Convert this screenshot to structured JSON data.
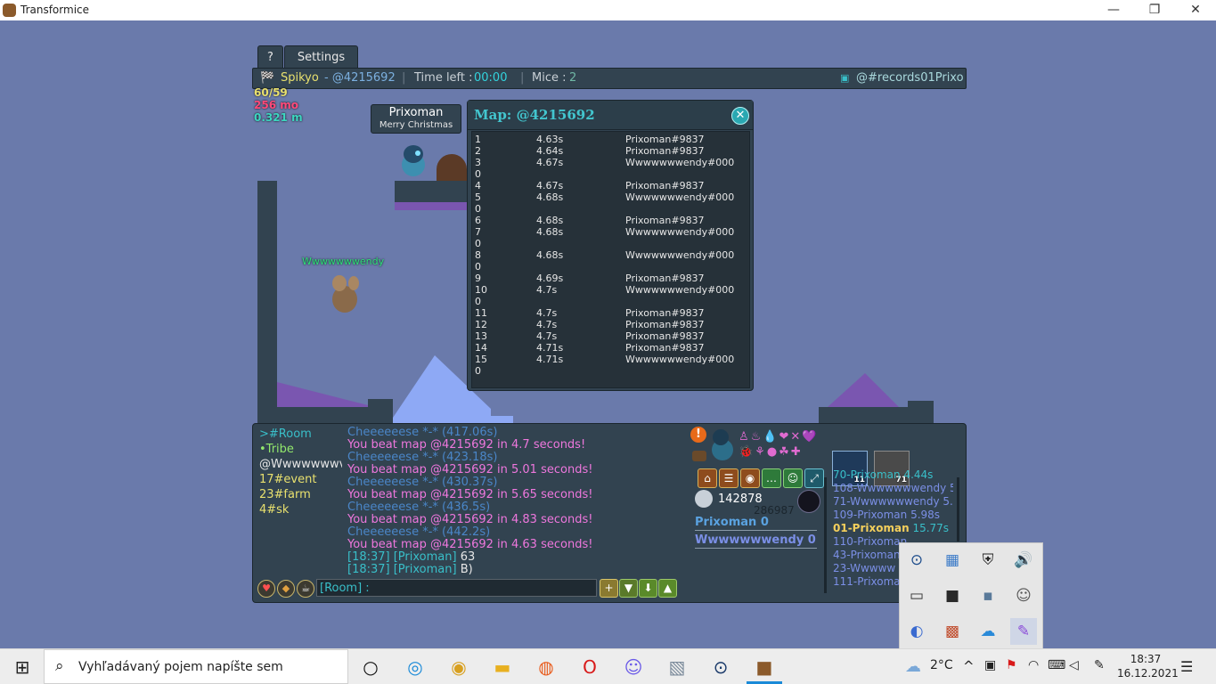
{
  "window": {
    "title": "Transformice",
    "controls": [
      "—",
      "❐",
      "✕"
    ]
  },
  "tabs": {
    "help": "?",
    "settings": "Settings"
  },
  "topbar": {
    "shaman": "Spikyo",
    "map_code": "- @4215692",
    "separator": "|",
    "time_label": "Time left :",
    "time_value": "00:00",
    "mice_label": "Mice :",
    "mice_value": "2",
    "room_tag": "@#records01Prixo"
  },
  "stats": {
    "fps": "60/59",
    "ping": "256 mo",
    "distance": "0.321 m"
  },
  "player_tag": {
    "name": "Prixoman",
    "title": "Merry Christmas"
  },
  "other_mouse": "Wwwwwwwendy",
  "map_window": {
    "title": "Map: @4215692",
    "close": "✕",
    "records": [
      {
        "rank": "1",
        "time": "4.63s",
        "name": "Prixoman#9837",
        "overflow": ""
      },
      {
        "rank": "2",
        "time": "4.64s",
        "name": "Prixoman#9837",
        "overflow": ""
      },
      {
        "rank": "3",
        "time": "4.67s",
        "name": "Wwwwwwwendy#000",
        "overflow": "0"
      },
      {
        "rank": "4",
        "time": "4.67s",
        "name": "Prixoman#9837",
        "overflow": ""
      },
      {
        "rank": "5",
        "time": "4.68s",
        "name": "Wwwwwwwendy#000",
        "overflow": "0"
      },
      {
        "rank": "6",
        "time": "4.68s",
        "name": "Prixoman#9837",
        "overflow": ""
      },
      {
        "rank": "7",
        "time": "4.68s",
        "name": "Wwwwwwwendy#000",
        "overflow": "0"
      },
      {
        "rank": "8",
        "time": "4.68s",
        "name": "Wwwwwwwendy#000",
        "overflow": "0"
      },
      {
        "rank": "9",
        "time": "4.69s",
        "name": "Prixoman#9837",
        "overflow": ""
      },
      {
        "rank": "10",
        "time": "4.7s",
        "name": "Wwwwwwwendy#000",
        "overflow": "0"
      },
      {
        "rank": "11",
        "time": "4.7s",
        "name": "Prixoman#9837",
        "overflow": ""
      },
      {
        "rank": "12",
        "time": "4.7s",
        "name": "Prixoman#9837",
        "overflow": ""
      },
      {
        "rank": "13",
        "time": "4.7s",
        "name": "Prixoman#9837",
        "overflow": ""
      },
      {
        "rank": "14",
        "time": "4.71s",
        "name": "Prixoman#9837",
        "overflow": ""
      },
      {
        "rank": "15",
        "time": "4.71s",
        "name": "Wwwwwwwendy#000",
        "overflow": "0"
      }
    ]
  },
  "chat": {
    "channels": [
      {
        "label": ">#Room",
        "color": "#39bfc9"
      },
      {
        "label": "•Tribe",
        "color": "#92e86c"
      },
      {
        "label": "@Wwwwwwwv",
        "color": "#e6e6e6"
      },
      {
        "label": "17#event",
        "color": "#e8e06e"
      },
      {
        "label": "23#farm",
        "color": "#e8e06e"
      },
      {
        "label": "4#sk",
        "color": "#e8e06e"
      }
    ],
    "messages": [
      {
        "text": "Cheeeeeese *-* (417.06s)",
        "color": "#4a86c8"
      },
      {
        "text": "You beat map @4215692 in 4.7 seconds!",
        "color": "#ee77dd"
      },
      {
        "text": "Cheeeeeese *-* (423.18s)",
        "color": "#4a86c8"
      },
      {
        "text": "You beat map @4215692 in 5.01 seconds!",
        "color": "#ee77dd"
      },
      {
        "text": "Cheeeeeese *-* (430.37s)",
        "color": "#4a86c8"
      },
      {
        "text": "You beat map @4215692 in 5.65 seconds!",
        "color": "#ee77dd"
      },
      {
        "text": "Cheeeeeese *-* (436.5s)",
        "color": "#4a86c8"
      },
      {
        "text": "You beat map @4215692 in 4.83 seconds!",
        "color": "#ee77dd"
      },
      {
        "text": "Cheeeeeese *-* (442.2s)",
        "color": "#4a86c8"
      },
      {
        "text": "You beat map @4215692 in 4.63 seconds!",
        "color": "#ee77dd"
      },
      {
        "text": "[18:37] [Prixoman]",
        "tail": " 63",
        "color": "#39bfc9"
      },
      {
        "text": "[18:37] [Prixoman]",
        "tail": " B)",
        "color": "#39bfc9"
      }
    ],
    "input_placeholder": "[Room] :"
  },
  "profile": {
    "cheese_count": "142878",
    "firsts_count": "286987",
    "players": [
      {
        "name": "Prixoman",
        "score": "0"
      },
      {
        "name": "Wwwwwwwendy",
        "score": "0"
      }
    ],
    "item_badges": [
      "11",
      "71"
    ]
  },
  "ranking": [
    {
      "text": "70-Prixoman 4.44s",
      "color": "#39bfc9",
      "bold": false
    },
    {
      "text": "108-Wwwwwwwendy 5.",
      "color": "#7b8fe6",
      "bold": false
    },
    {
      "text": "71-Wwwwwwwendy 5.7",
      "color": "#7b8fe6",
      "bold": false
    },
    {
      "text": "109-Prixoman 5.98s",
      "color": "#7b8fe6",
      "bold": false
    },
    {
      "text": "01-Prixoman",
      "tail": " 15.77s",
      "color": "#f4cf5c",
      "bold": true
    },
    {
      "text": "110-Prixoman",
      "color": "#7b8fe6",
      "bold": false
    },
    {
      "text": "43-Prixoman",
      "color": "#7b8fe6",
      "bold": false
    },
    {
      "text": "23-Wwwww",
      "color": "#7b8fe6",
      "bold": false
    },
    {
      "text": "111-Prixoma",
      "color": "#7b8fe6",
      "bold": false
    }
  ],
  "taskbar": {
    "search_placeholder": "Vyhľadávaný pojem napíšte sem",
    "weather": "2°C",
    "time": "18:37",
    "date": "16.12.2021"
  },
  "colors": {
    "game_bg": "#6a7aab",
    "panel": "#324350",
    "accent": "#39bfc9"
  }
}
